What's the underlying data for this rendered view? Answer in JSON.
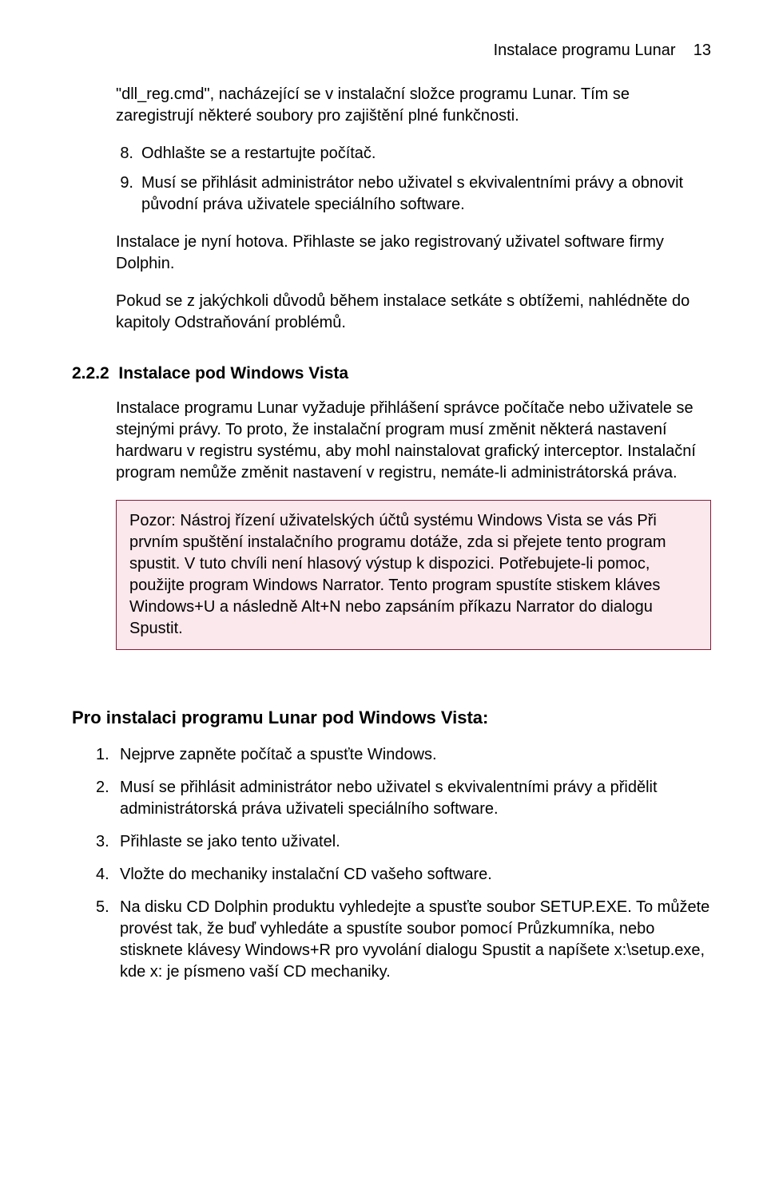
{
  "header": {
    "title": "Instalace programu Lunar",
    "page": "13"
  },
  "intro_para": "\"dll_reg.cmd\", nacházející se v instalační složce programu Lunar.  Tím se zaregistrují některé soubory pro zajištění plné funkčnosti.",
  "list1": [
    {
      "num": "8.",
      "text": "Odhlašte se a restartujte počítač."
    },
    {
      "num": "9.",
      "text": "Musí se přihlásit administrátor nebo uživatel s ekvivalentními právy a obnovit původní práva uživatele speciálního software."
    }
  ],
  "para2": "Instalace je nyní hotova. Přihlaste se jako registrovaný uživatel software firmy Dolphin.",
  "para3": "Pokud se z jakýchkoli důvodů během instalace setkáte s obtížemi, nahlédněte do kapitoly Odstraňování problémů.",
  "section": {
    "number": "2.2.2",
    "title": "Instalace pod Windows Vista"
  },
  "section_para": "Instalace programu Lunar vyžaduje přihlášení správce počítače nebo uživatele se stejnými právy. To proto, že instalační program musí změnit některá nastavení hardwaru v registru systému, aby mohl nainstalovat grafický interceptor. Instalační program nemůže změnit nastavení v registru, nemáte-li administrátorská práva.",
  "callout_text": "Pozor: Nástroj řízení uživatelských účtů systému Windows Vista se vás Při prvním spuštění instalačního programu dotáže, zda si přejete tento program spustit.  V tuto chvíli není hlasový výstup k dispozici.  Potřebujete-li pomoc, použijte program Windows Narrator.  Tento program spustíte stiskem kláves Windows+U a následně Alt+N nebo zapsáním příkazu Narrator do dialogu Spustit.",
  "heading2": "Pro instalaci programu Lunar pod Windows Vista:",
  "list2": [
    {
      "num": "1.",
      "text": "Nejprve zapněte počítač a spusťte Windows."
    },
    {
      "num": "2.",
      "text": "Musí se přihlásit administrátor nebo uživatel s ekvivalentními právy a přidělit administrátorská práva uživateli speciálního software."
    },
    {
      "num": "3.",
      "text": "Přihlaste se jako tento uživatel."
    },
    {
      "num": "4.",
      "text": "Vložte do mechaniky instalační CD vašeho software."
    },
    {
      "num": "5.",
      "text": "Na disku CD Dolphin produktu vyhledejte a spusťte soubor SETUP.EXE.  To můžete provést tak, že buď vyhledáte a spustíte soubor pomocí Průzkumníka, nebo stisknete klávesy Windows+R pro vyvolání dialogu Spustit a napíšete x:\\setup.exe, kde x: je písmeno vaší CD mechaniky."
    }
  ]
}
